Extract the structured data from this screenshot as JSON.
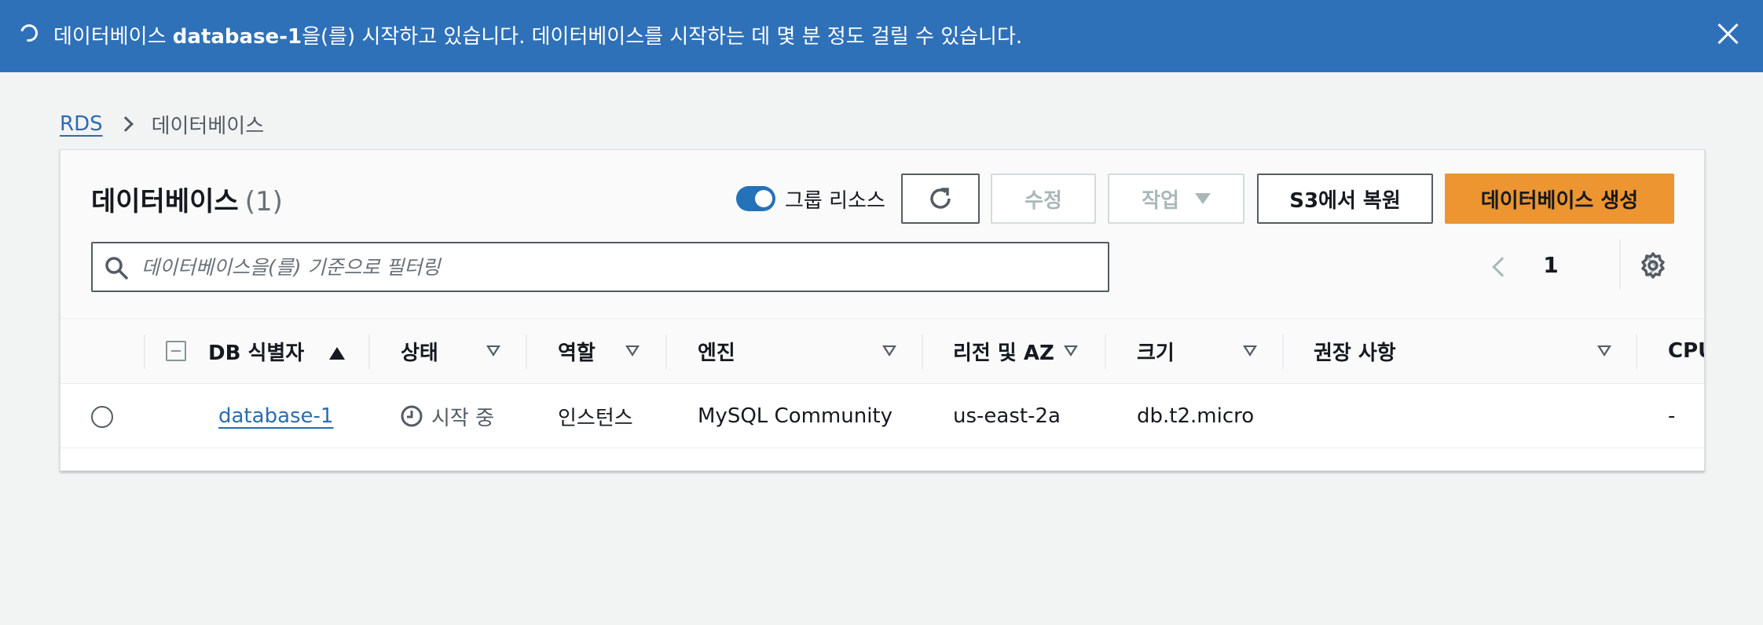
{
  "flash": {
    "message_prefix": "데이터베이스 ",
    "message_bold": "database-1",
    "message_suffix": "을(를) 시작하고 있습니다. 데이터베이스를 시작하는 데 몇 분 정도 걸릴 수 있습니다.",
    "color": "#2f71b8"
  },
  "breadcrumb": {
    "items": [
      "RDS",
      "데이터베이스"
    ]
  },
  "panel": {
    "title": "데이터베이스",
    "count": "(1)",
    "toggle_label": "그룹 리소스",
    "toggle_on": true,
    "buttons": {
      "modify": "수정",
      "actions": "작업",
      "restore_s3": "S3에서 복원",
      "create": "데이터베이스 생성"
    },
    "search_placeholder": "데이터베이스을(를) 기준으로 필터링",
    "page": "1",
    "accent_color": "#ec9531"
  },
  "table": {
    "columns": [
      "DB 식별자",
      "상태",
      "역할",
      "엔진",
      "리전 및 AZ",
      "크기",
      "권장 사항",
      "CPU"
    ],
    "rows": [
      {
        "identifier": "database-1",
        "status": "시작 중",
        "role": "인스턴스",
        "engine": "MySQL Community",
        "region_az": "us-east-2a",
        "size": "db.t2.micro",
        "recommendations": "",
        "cpu": "-"
      }
    ]
  }
}
